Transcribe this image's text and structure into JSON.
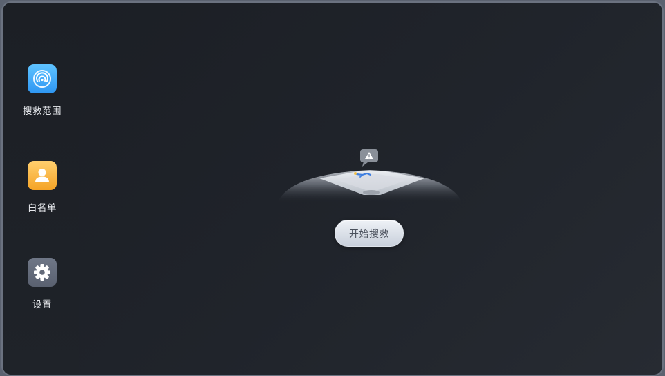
{
  "sidebar": {
    "items": [
      {
        "label": "搜救范围",
        "icon": "signal-radar-icon",
        "color": "#3aa2f5"
      },
      {
        "label": "白名单",
        "icon": "user-icon",
        "color": "#f7ae36"
      },
      {
        "label": "设置",
        "icon": "gear-icon",
        "color": "#646b7a"
      }
    ]
  },
  "main": {
    "illustration": "search-rescue-field-illustration",
    "start_button_label": "开始搜救"
  }
}
